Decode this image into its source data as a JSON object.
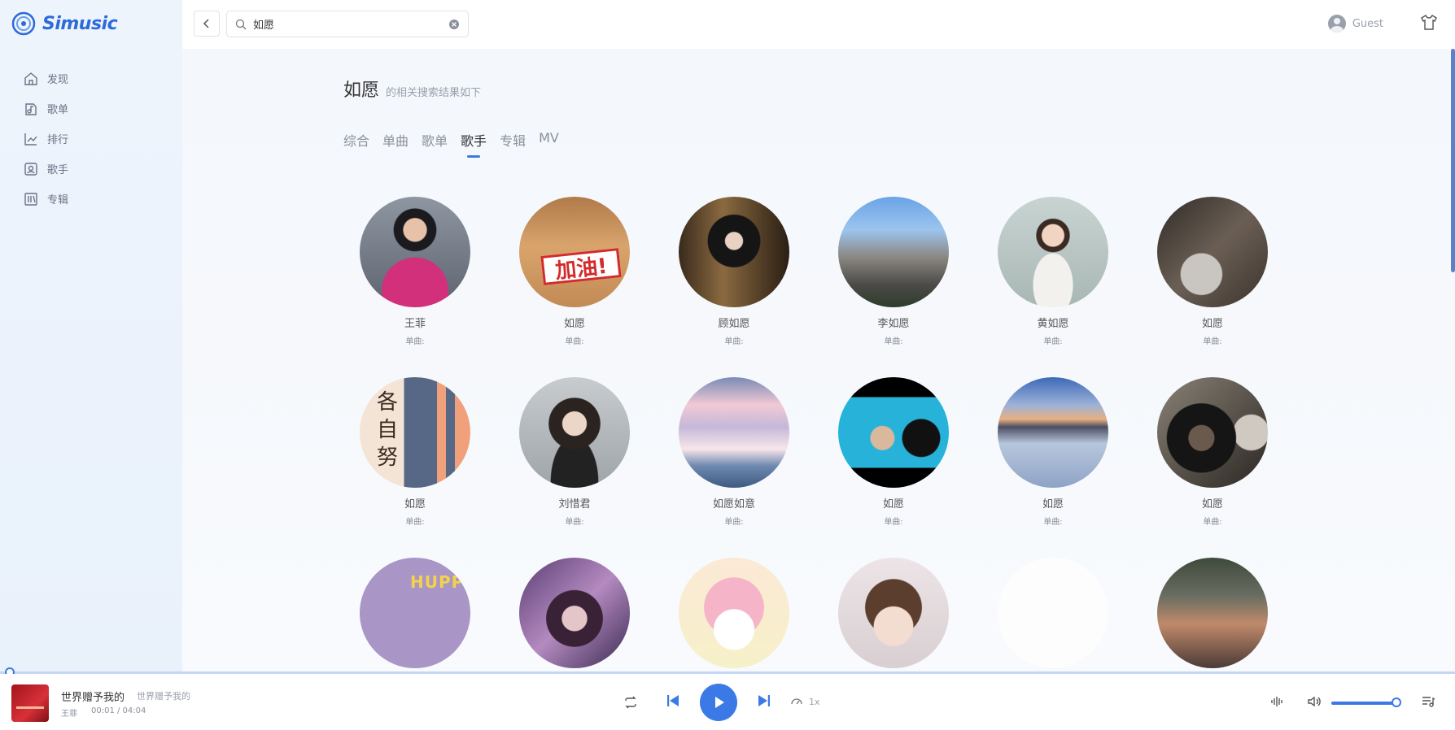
{
  "app": {
    "logo_text": "Simusic"
  },
  "sidebar": {
    "items": [
      {
        "label": "发现",
        "icon": "home-icon"
      },
      {
        "label": "歌单",
        "icon": "playlist-icon"
      },
      {
        "label": "排行",
        "icon": "chart-icon"
      },
      {
        "label": "歌手",
        "icon": "singer-icon"
      },
      {
        "label": "专辑",
        "icon": "album-icon"
      }
    ]
  },
  "topbar": {
    "search_value": "如愿",
    "user_name": "Guest"
  },
  "results": {
    "keyword": "如愿",
    "subtitle": "的相关搜索结果如下",
    "tabs": [
      "综合",
      "单曲",
      "歌单",
      "歌手",
      "专辑",
      "MV"
    ],
    "active_tab": "歌手",
    "artists": [
      {
        "name": "王菲",
        "meta": "单曲:"
      },
      {
        "name": "如愿",
        "meta": "单曲:"
      },
      {
        "name": "顾如愿",
        "meta": "单曲:"
      },
      {
        "name": "李如愿",
        "meta": "单曲:"
      },
      {
        "name": "黄如愿",
        "meta": "单曲:"
      },
      {
        "name": "如愿",
        "meta": "单曲:"
      },
      {
        "name": "如愿",
        "meta": "单曲:"
      },
      {
        "name": "刘惜君",
        "meta": "单曲:"
      },
      {
        "name": "如愿如意",
        "meta": "单曲:"
      },
      {
        "name": "如愿",
        "meta": "单曲:"
      },
      {
        "name": "如愿",
        "meta": "单曲:"
      },
      {
        "name": "如愿",
        "meta": "单曲:"
      },
      {
        "name": "",
        "meta": ""
      },
      {
        "name": "",
        "meta": ""
      },
      {
        "name": "",
        "meta": ""
      },
      {
        "name": "",
        "meta": ""
      },
      {
        "name": "",
        "meta": ""
      },
      {
        "name": "",
        "meta": ""
      }
    ],
    "cover_text_1": "加油!",
    "cover_text_2": "各自努",
    "cover_text_3": "HUPP"
  },
  "player": {
    "song_title": "世界赠予我的",
    "album": "世界赠予我的",
    "artist": "王菲",
    "time": "00:01 / 04:04",
    "speed": "1x",
    "accent": "#3b7ae6"
  }
}
